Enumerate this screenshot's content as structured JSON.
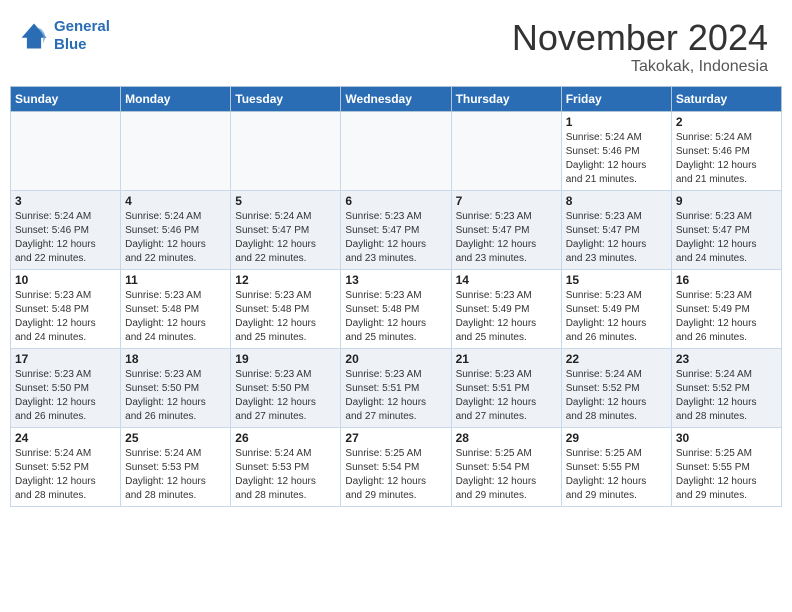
{
  "header": {
    "logo_line1": "General",
    "logo_line2": "Blue",
    "month": "November 2024",
    "location": "Takokak, Indonesia"
  },
  "days_of_week": [
    "Sunday",
    "Monday",
    "Tuesday",
    "Wednesday",
    "Thursday",
    "Friday",
    "Saturday"
  ],
  "weeks": [
    [
      {
        "day": "",
        "info": ""
      },
      {
        "day": "",
        "info": ""
      },
      {
        "day": "",
        "info": ""
      },
      {
        "day": "",
        "info": ""
      },
      {
        "day": "",
        "info": ""
      },
      {
        "day": "1",
        "info": "Sunrise: 5:24 AM\nSunset: 5:46 PM\nDaylight: 12 hours\nand 21 minutes."
      },
      {
        "day": "2",
        "info": "Sunrise: 5:24 AM\nSunset: 5:46 PM\nDaylight: 12 hours\nand 21 minutes."
      }
    ],
    [
      {
        "day": "3",
        "info": "Sunrise: 5:24 AM\nSunset: 5:46 PM\nDaylight: 12 hours\nand 22 minutes."
      },
      {
        "day": "4",
        "info": "Sunrise: 5:24 AM\nSunset: 5:46 PM\nDaylight: 12 hours\nand 22 minutes."
      },
      {
        "day": "5",
        "info": "Sunrise: 5:24 AM\nSunset: 5:47 PM\nDaylight: 12 hours\nand 22 minutes."
      },
      {
        "day": "6",
        "info": "Sunrise: 5:23 AM\nSunset: 5:47 PM\nDaylight: 12 hours\nand 23 minutes."
      },
      {
        "day": "7",
        "info": "Sunrise: 5:23 AM\nSunset: 5:47 PM\nDaylight: 12 hours\nand 23 minutes."
      },
      {
        "day": "8",
        "info": "Sunrise: 5:23 AM\nSunset: 5:47 PM\nDaylight: 12 hours\nand 23 minutes."
      },
      {
        "day": "9",
        "info": "Sunrise: 5:23 AM\nSunset: 5:47 PM\nDaylight: 12 hours\nand 24 minutes."
      }
    ],
    [
      {
        "day": "10",
        "info": "Sunrise: 5:23 AM\nSunset: 5:48 PM\nDaylight: 12 hours\nand 24 minutes."
      },
      {
        "day": "11",
        "info": "Sunrise: 5:23 AM\nSunset: 5:48 PM\nDaylight: 12 hours\nand 24 minutes."
      },
      {
        "day": "12",
        "info": "Sunrise: 5:23 AM\nSunset: 5:48 PM\nDaylight: 12 hours\nand 25 minutes."
      },
      {
        "day": "13",
        "info": "Sunrise: 5:23 AM\nSunset: 5:48 PM\nDaylight: 12 hours\nand 25 minutes."
      },
      {
        "day": "14",
        "info": "Sunrise: 5:23 AM\nSunset: 5:49 PM\nDaylight: 12 hours\nand 25 minutes."
      },
      {
        "day": "15",
        "info": "Sunrise: 5:23 AM\nSunset: 5:49 PM\nDaylight: 12 hours\nand 26 minutes."
      },
      {
        "day": "16",
        "info": "Sunrise: 5:23 AM\nSunset: 5:49 PM\nDaylight: 12 hours\nand 26 minutes."
      }
    ],
    [
      {
        "day": "17",
        "info": "Sunrise: 5:23 AM\nSunset: 5:50 PM\nDaylight: 12 hours\nand 26 minutes."
      },
      {
        "day": "18",
        "info": "Sunrise: 5:23 AM\nSunset: 5:50 PM\nDaylight: 12 hours\nand 26 minutes."
      },
      {
        "day": "19",
        "info": "Sunrise: 5:23 AM\nSunset: 5:50 PM\nDaylight: 12 hours\nand 27 minutes."
      },
      {
        "day": "20",
        "info": "Sunrise: 5:23 AM\nSunset: 5:51 PM\nDaylight: 12 hours\nand 27 minutes."
      },
      {
        "day": "21",
        "info": "Sunrise: 5:23 AM\nSunset: 5:51 PM\nDaylight: 12 hours\nand 27 minutes."
      },
      {
        "day": "22",
        "info": "Sunrise: 5:24 AM\nSunset: 5:52 PM\nDaylight: 12 hours\nand 28 minutes."
      },
      {
        "day": "23",
        "info": "Sunrise: 5:24 AM\nSunset: 5:52 PM\nDaylight: 12 hours\nand 28 minutes."
      }
    ],
    [
      {
        "day": "24",
        "info": "Sunrise: 5:24 AM\nSunset: 5:52 PM\nDaylight: 12 hours\nand 28 minutes."
      },
      {
        "day": "25",
        "info": "Sunrise: 5:24 AM\nSunset: 5:53 PM\nDaylight: 12 hours\nand 28 minutes."
      },
      {
        "day": "26",
        "info": "Sunrise: 5:24 AM\nSunset: 5:53 PM\nDaylight: 12 hours\nand 28 minutes."
      },
      {
        "day": "27",
        "info": "Sunrise: 5:25 AM\nSunset: 5:54 PM\nDaylight: 12 hours\nand 29 minutes."
      },
      {
        "day": "28",
        "info": "Sunrise: 5:25 AM\nSunset: 5:54 PM\nDaylight: 12 hours\nand 29 minutes."
      },
      {
        "day": "29",
        "info": "Sunrise: 5:25 AM\nSunset: 5:55 PM\nDaylight: 12 hours\nand 29 minutes."
      },
      {
        "day": "30",
        "info": "Sunrise: 5:25 AM\nSunset: 5:55 PM\nDaylight: 12 hours\nand 29 minutes."
      }
    ]
  ],
  "colors": {
    "header_bg": "#2a6db5",
    "header_text": "#ffffff",
    "row_even": "#eef2f7",
    "row_odd": "#ffffff",
    "empty_cell": "#f8f9fa"
  }
}
